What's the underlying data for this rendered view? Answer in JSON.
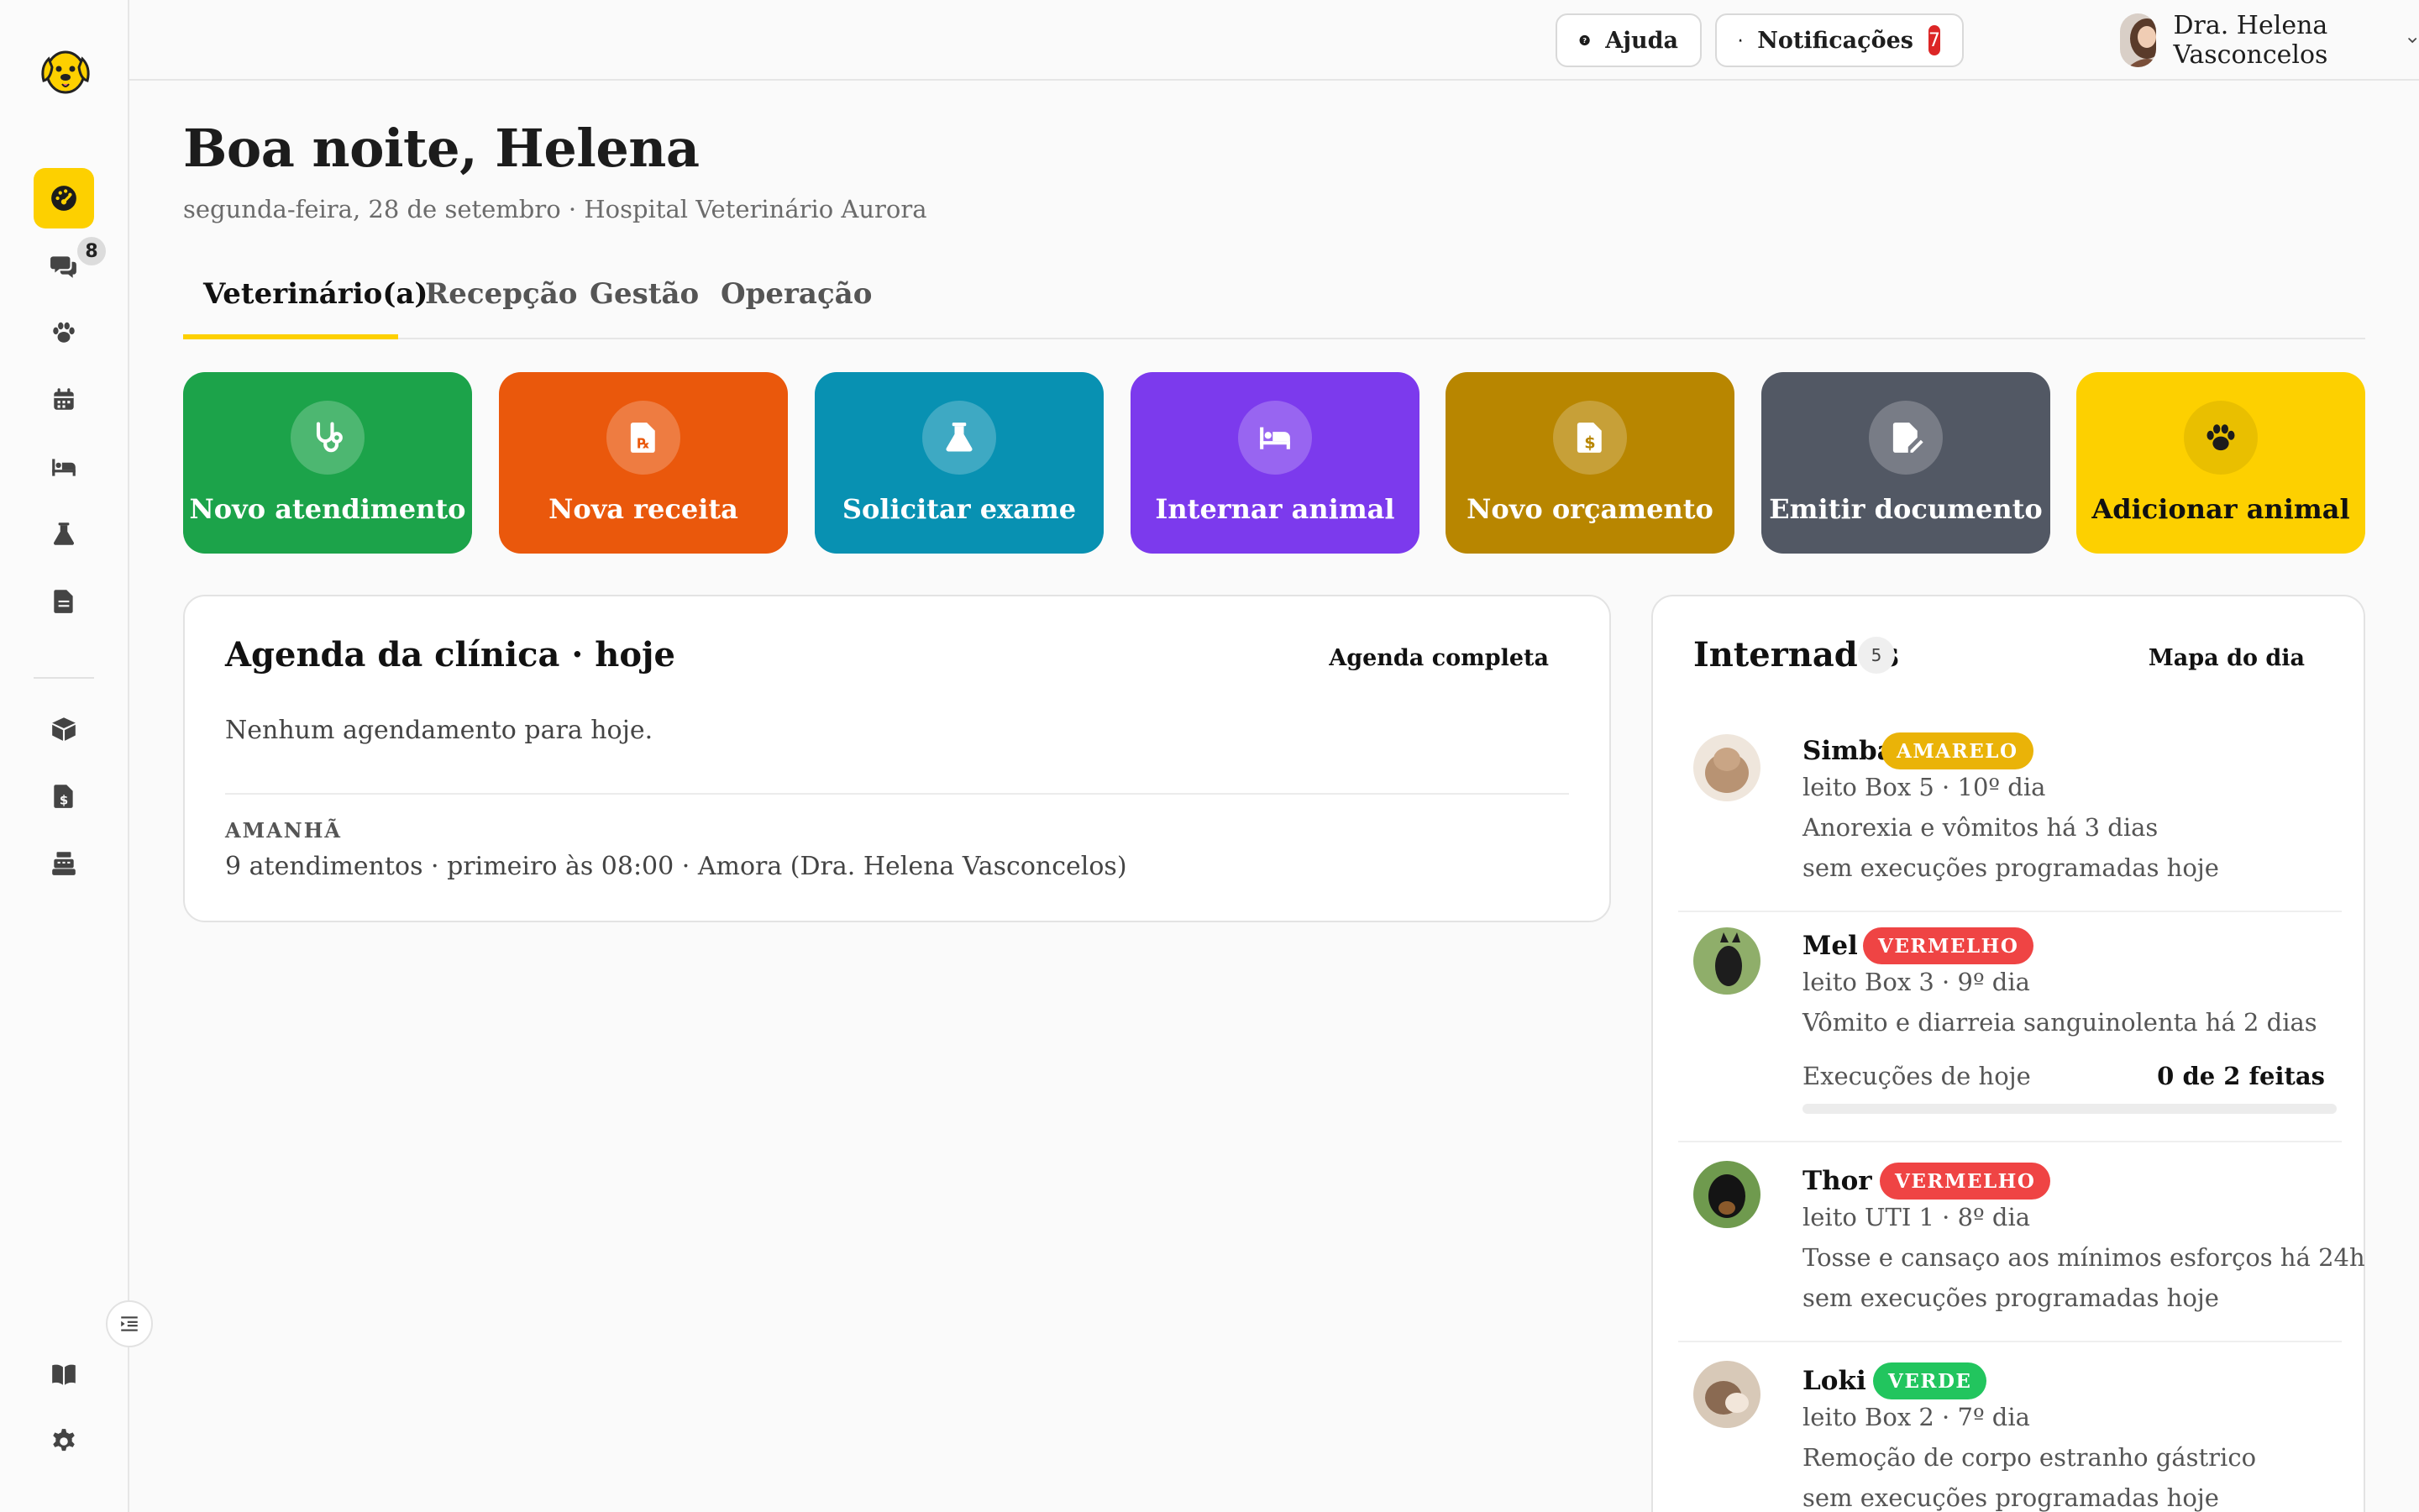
{
  "colors": {
    "brand_yellow": "#fdd000",
    "novo_atendimento": "#1ca34a",
    "nova_receita": "#ea580c",
    "solicitar_exame": "#0891b2",
    "internar_animal": "#7c3aed",
    "novo_orcamento": "#b88600",
    "emitir_documento": "#525864",
    "adicionar_animal": "#fdd000",
    "status_amarelo": "#eab308",
    "status_vermelho": "#ef4444",
    "status_verde": "#22c55e"
  },
  "sidebar": {
    "items": [
      {
        "icon": "dashboard-gauge-icon",
        "active": true
      },
      {
        "icon": "chat-bubbles-icon",
        "badge": "8"
      },
      {
        "icon": "paw-icon"
      },
      {
        "icon": "calendar-icon"
      },
      {
        "icon": "bed-icon"
      },
      {
        "icon": "flask-icon"
      },
      {
        "icon": "document-icon"
      },
      {
        "icon": "box-icon"
      },
      {
        "icon": "invoice-dollar-icon"
      },
      {
        "icon": "cash-register-icon"
      }
    ],
    "bottom": [
      {
        "icon": "book-icon"
      },
      {
        "icon": "gear-icon"
      }
    ]
  },
  "header": {
    "help_label": "Ajuda",
    "notifications_label": "Notificações",
    "notifications_count": "7",
    "user_name": "Dra. Helena Vasconcelos"
  },
  "main": {
    "greeting": "Boa noite, Helena",
    "subtitle": "segunda-feira, 28 de setembro · Hospital Veterinário Aurora",
    "tabs": [
      {
        "label": "Veterinário(a)",
        "active": true
      },
      {
        "label": "Recepção"
      },
      {
        "label": "Gestão"
      },
      {
        "label": "Operação"
      }
    ],
    "actions": [
      {
        "label": "Novo atendimento",
        "icon": "stethoscope-icon"
      },
      {
        "label": "Nova receita",
        "icon": "prescription-icon"
      },
      {
        "label": "Solicitar exame",
        "icon": "flask-icon"
      },
      {
        "label": "Internar animal",
        "icon": "bed-icon"
      },
      {
        "label": "Novo orçamento",
        "icon": "invoice-dollar-icon"
      },
      {
        "label": "Emitir documento",
        "icon": "file-signature-icon"
      },
      {
        "label": "Adicionar animal",
        "icon": "paw-icon"
      }
    ]
  },
  "agenda": {
    "title": "Agenda da clínica · hoje",
    "link": "Agenda completa",
    "empty": "Nenhum agendamento para hoje.",
    "tomorrow_label": "AMANHÃ",
    "tomorrow_text": "9 atendimentos · primeiro às 08:00 · Amora (Dra. Helena Vasconcelos)"
  },
  "internados": {
    "title": "Internados",
    "count": "5",
    "link": "Mapa do dia",
    "patients": [
      {
        "name": "Simba",
        "status": "AMARELO",
        "status_color": "#eab308",
        "bed": "leito Box 5 · 10º dia",
        "complaint": "Anorexia e vômitos há 3 dias",
        "note": "sem execuções programadas hoje"
      },
      {
        "name": "Mel",
        "status": "VERMELHO",
        "status_color": "#ef4444",
        "bed": "leito Box 3 · 9º dia",
        "complaint": "Vômito e diarreia sanguinolenta há 2 dias",
        "exec_label": "Execuções de hoje",
        "exec_count": "0 de 2 feitas",
        "exec_progress": 0
      },
      {
        "name": "Thor",
        "status": "VERMELHO",
        "status_color": "#ef4444",
        "bed": "leito UTI 1 · 8º dia",
        "complaint": "Tosse e cansaço aos mínimos esforços há 24h",
        "note": "sem execuções programadas hoje"
      },
      {
        "name": "Loki",
        "status": "VERDE",
        "status_color": "#22c55e",
        "bed": "leito Box 2 · 7º dia",
        "complaint": "Remoção de corpo estranho gástrico",
        "note": "sem execuções programadas hoje"
      }
    ]
  }
}
